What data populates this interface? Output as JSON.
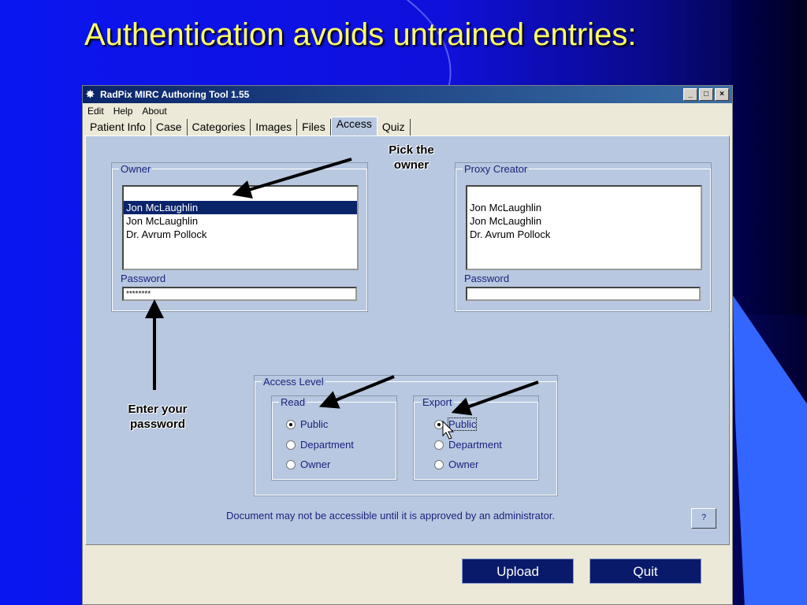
{
  "slide": {
    "title": "Authentication avoids untrained entries:"
  },
  "window": {
    "title": "RadPix MIRC Authoring Tool 1.55",
    "controls": {
      "minimize": "_",
      "maximize": "□",
      "close": "×"
    }
  },
  "menu": [
    "Edit",
    "Help",
    "About"
  ],
  "tabs": [
    "Patient Info",
    "Case",
    "Categories",
    "Images",
    "Files",
    "Access",
    "Quiz"
  ],
  "active_tab": "Access",
  "owner": {
    "legend": "Owner",
    "items": [
      "Jon McLaughlin",
      "Jon McLaughlin",
      "Dr. Avrum Pollock"
    ],
    "selected_index": 0,
    "password_label": "Password",
    "password_value": "********"
  },
  "proxy": {
    "legend": "Proxy Creator",
    "items": [
      "Jon McLaughlin",
      "Jon McLaughlin",
      "Dr. Avrum Pollock"
    ],
    "password_label": "Password",
    "password_value": ""
  },
  "access_level": {
    "legend": "Access Level",
    "read": {
      "legend": "Read",
      "options": [
        "Public",
        "Department",
        "Owner"
      ],
      "selected": "Public"
    },
    "export": {
      "legend": "Export",
      "options": [
        "Public",
        "Department",
        "Owner"
      ],
      "selected": "Public"
    }
  },
  "notice": "Document may not be accessible until it is approved by an administrator.",
  "help_label": "?",
  "buttons": {
    "upload": "Upload",
    "quit": "Quit"
  },
  "annotations": {
    "pick_owner": [
      "Pick the",
      "owner"
    ],
    "enter_password": [
      "Enter your",
      "password"
    ]
  },
  "colors": {
    "slide_bg": "#1010dc",
    "title": "#ffff66",
    "panel": "#b8c8e0",
    "button": "#0a1a6a"
  }
}
